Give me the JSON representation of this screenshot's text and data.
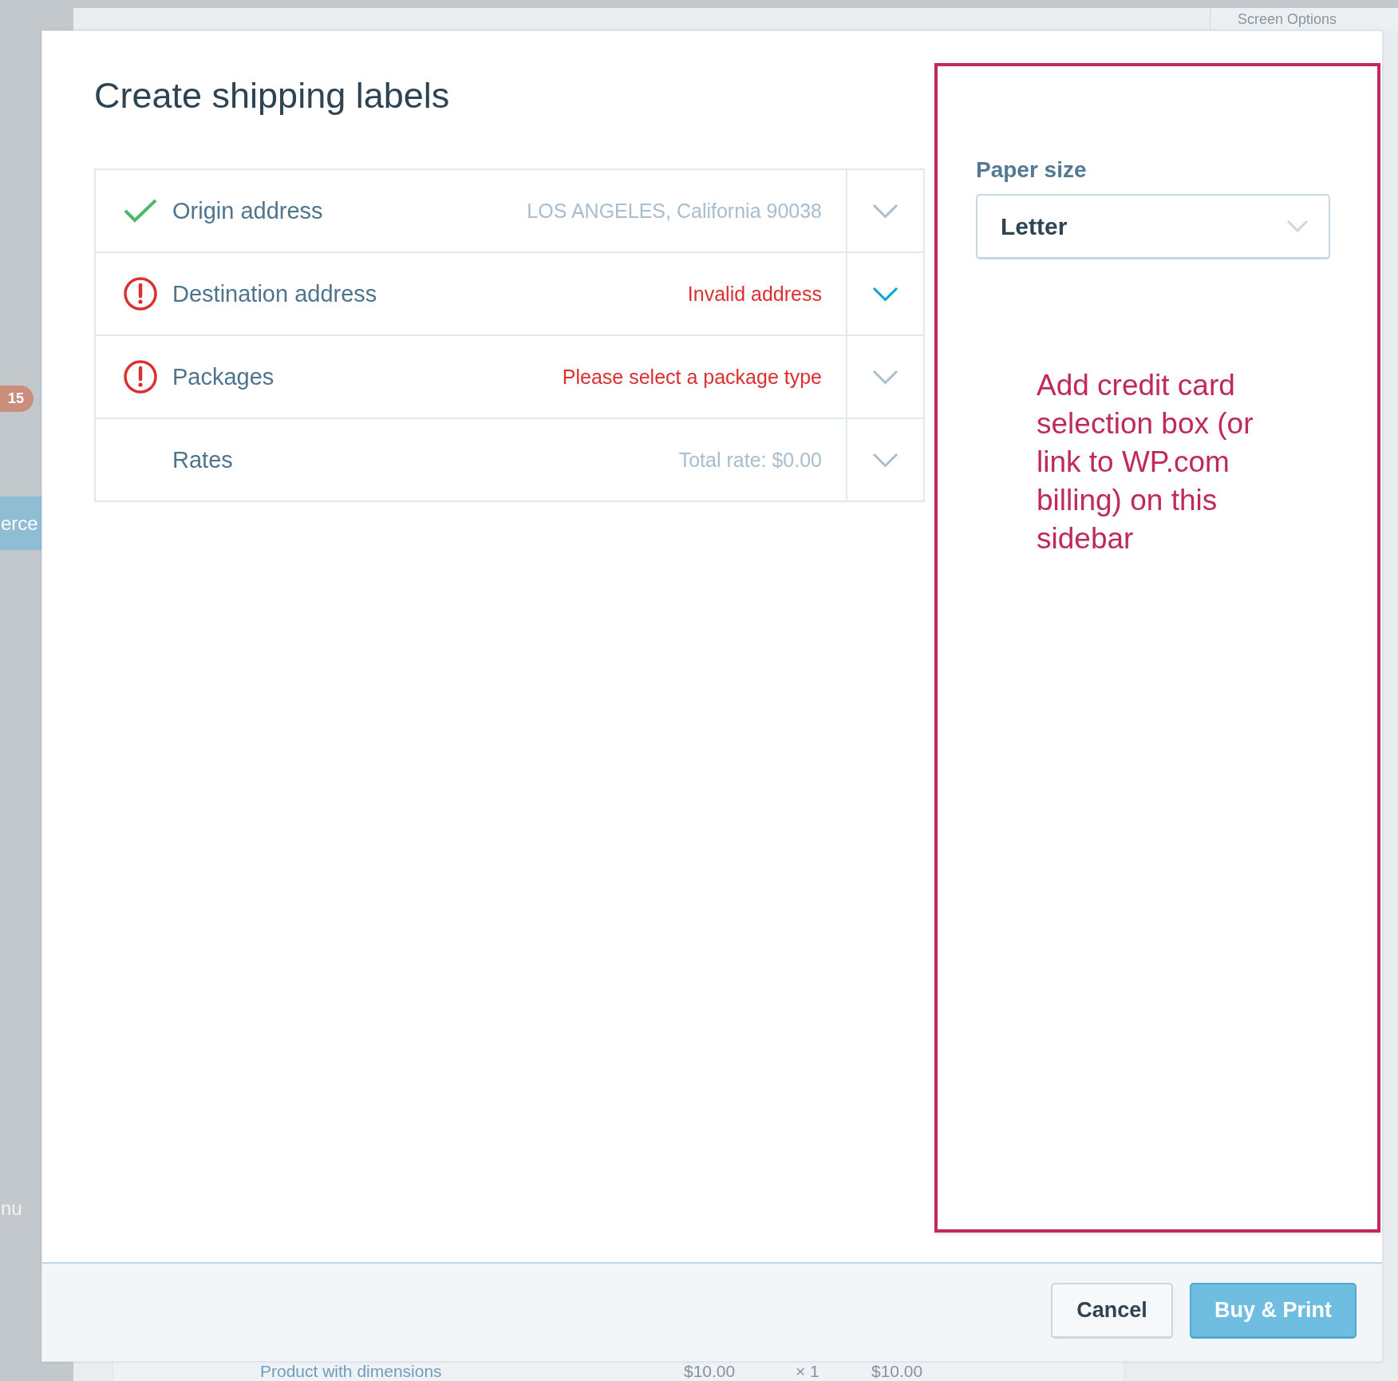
{
  "background": {
    "sidebar": {
      "badge": "15",
      "menu_items": [
        {
          "label": "erce",
          "selected": true
        },
        {
          "label": "nu",
          "selected": false
        }
      ]
    },
    "screen_options": "Screen Options",
    "product_row": {
      "name": "Product with dimensions",
      "price": "$10.00",
      "quantity": "× 1",
      "total": "$10.00"
    }
  },
  "dialog": {
    "title": "Create shipping labels",
    "steps": [
      {
        "kind": "done",
        "title": "Origin address",
        "summary": "LOS ANGELES, California 90038",
        "selected": false
      },
      {
        "kind": "error",
        "title": "Destination address",
        "summary": "Invalid address",
        "selected": true
      },
      {
        "kind": "error",
        "title": "Packages",
        "summary": "Please select a package type",
        "selected": false
      },
      {
        "kind": "plain",
        "title": "Rates",
        "summary": "Total rate: $0.00",
        "selected": false
      }
    ],
    "sidebar": {
      "paper_size": {
        "label": "Paper size",
        "value": "Letter"
      },
      "annotation": "Add credit card selection box (or link to WP.com billing) on this sidebar"
    },
    "buttons": [
      {
        "kind": "secondary",
        "label": "Cancel",
        "disabled": false
      },
      {
        "kind": "primary",
        "label": "Buy & Print",
        "disabled": true
      }
    ]
  }
}
